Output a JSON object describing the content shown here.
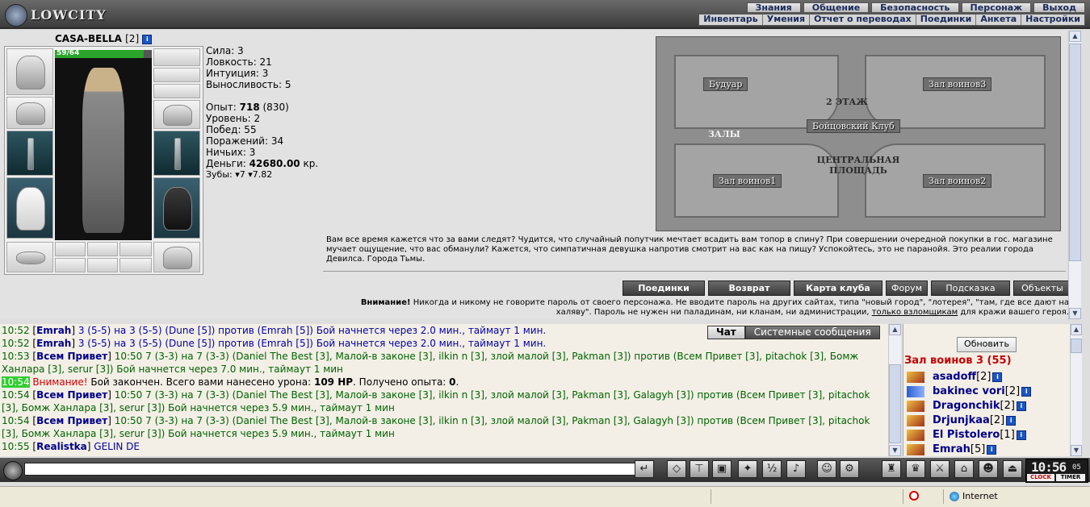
{
  "logo": "LOWCITY",
  "top_menu_row1": [
    "Знания",
    "Общение",
    "Безопасность",
    "Персонаж",
    "Выход"
  ],
  "top_menu_row2": [
    "Инвентарь",
    "Умения",
    "Отчет о переводах",
    "Поединки",
    "Анкета",
    "Настройки"
  ],
  "character": {
    "name": "CASA-BELLA",
    "level": "[2]",
    "info_icon": "i",
    "hp_text": "59/64",
    "hp_fraction": 0.92
  },
  "stats": {
    "strength": "Сила: 3",
    "agility": "Ловкость: 21",
    "intuition": "Интуиция: 3",
    "endurance": "Выносливость: 5",
    "exp_label": "Опыт: ",
    "exp_value": "718",
    "exp_next": " (830)",
    "level": "Уровень: 2",
    "wins": "Побед: 55",
    "losses": "Поражений: 34",
    "draws": "Ничьих: 3",
    "money_label": "Деньги: ",
    "money_value": "42680.00",
    "money_unit": " кр.",
    "teeth_label": "Зубы: ",
    "teeth_a": "7",
    "teeth_b": "7.82"
  },
  "map": {
    "floor": "2 ЭТАЖ",
    "rooms": [
      "Будуар",
      "Зал воинов3",
      "ЗАЛЫ",
      "Бойцовский Клуб",
      "ЦЕНТРАЛЬНАЯ ПЛОЩАДЬ",
      "Зал воинов1",
      "Зал воинов2"
    ]
  },
  "flavor_text": "Вам все время кажется что за вами следят? Чудится, что случайный попутчик мечтает всадить вам топор в спину? При совершении очередной покупки в гос. магазине мучает ощущение, что вас обманули? Кажется, что симпатичная девушка напротив смотрит на вас как на пищу? Успокойтесь, это не паранойя. Это реалии города Девилса. Города Тьмы.",
  "action_buttons": [
    "Поединки",
    "Возврат",
    "Карта клуба",
    "Форум",
    "Подсказка",
    "Объекты"
  ],
  "warning": {
    "label": "Внимание!",
    "text": " Никогда и никому не говорите пароль от своего персонажа. Не вводите пароль на других сайтах, типа \"новый город\", \"лотерея\", \"там, где все дают на халяву\". Пароль не нужен ни паладинам, ни кланам, ни администрации, ",
    "link": "только взломщикам",
    "tail": " для кражи вашего героя."
  },
  "chat_tabs": [
    "Чат",
    "Системные сообщения"
  ],
  "chat": [
    {
      "time": "10:52",
      "nick": "Emrah",
      "text": " 3 (5-5) на 3 (5-5) (Dune [5]) против (Emrah [5]) Бой начнется через 2.0 мин., таймаут 1 мин.",
      "style": "blue"
    },
    {
      "time": "10:52",
      "nick": "Emrah",
      "text": " 3 (5-5) на 3 (5-5) (Dune [5]) против (Emrah [5]) Бой начнется через 2.0 мин., таймаут 1 мин.",
      "style": "blue"
    },
    {
      "time": "10:53",
      "nick": "Всем Привет",
      "text": " 10:50 7 (3-3) на 7 (3-3) (Daniel The Best [3], Малой-в законе [3], ilkin n [3], злой малой [3], Pakman [3]) против (Всем Привет [3], pitachok [3], Бомж Ханлара [3], serur [3]) Бой начнется через 7.0 мин., таймаут 1 мин",
      "style": "green"
    },
    {
      "time": "10:54",
      "system": true,
      "label": "Внимание!",
      "text": " Бой закончен. Всего вами нанесено урона: ",
      "dmg": "109 HP",
      "mid": ". Получено опыта: ",
      "exp": "0",
      "end": "."
    },
    {
      "time": "10:54",
      "nick": "Всем Привет",
      "text": " 10:50 7 (3-3) на 7 (3-3) (Daniel The Best [3], Малой-в законе [3], ilkin n [3], злой малой [3], Pakman [3], Galagyh [3]) против (Всем Привет [3], pitachok [3], Бомж Ханлара [3], serur [3]) Бой начнется через 5.9 мин., таймаут 1 мин",
      "style": "green"
    },
    {
      "time": "10:54",
      "nick": "Всем Привет",
      "text": " 10:50 7 (3-3) на 7 (3-3) (Daniel The Best [3], Малой-в законе [3], ilkin n [3], злой малой [3], Pakman [3], Galagyh [3]) против (Всем Привет [3], pitachok [3], Бомж Ханлара [3], serur [3]) Бой начнется через 5.9 мин., таймаут 1 мин",
      "style": "green"
    },
    {
      "time": "10:55",
      "nick": "Realistka",
      "text": " GELIN DE",
      "style": "blue"
    }
  ],
  "room_panel": {
    "refresh": "Обновить",
    "title": "Зал воинов 3 (55)",
    "users": [
      {
        "name": "asadoff",
        "level": "[2]",
        "icon": "fight-icon"
      },
      {
        "name": "bakinec vori",
        "level": "[2]",
        "icon": "transfer-icon"
      },
      {
        "name": "Dragonchik",
        "level": "[2]",
        "icon": "fight-icon"
      },
      {
        "name": "Drjunjkaa",
        "level": "[2]",
        "icon": "fight-icon"
      },
      {
        "name": "El Pistolero",
        "level": "[1]",
        "icon": "fight-icon"
      },
      {
        "name": "Emrah",
        "level": "[5]",
        "icon": "fight-icon"
      }
    ]
  },
  "clock": {
    "time": "10:56",
    "seconds": "05",
    "label1": "CLOCK",
    "label2": "TIMER"
  },
  "status_bar": {
    "zone": "Internet"
  },
  "colors": {
    "hp_green": "#2ba42b",
    "nick_blue": "#00008b",
    "room_title_red": "#c80000",
    "chat_green": "#006400"
  }
}
